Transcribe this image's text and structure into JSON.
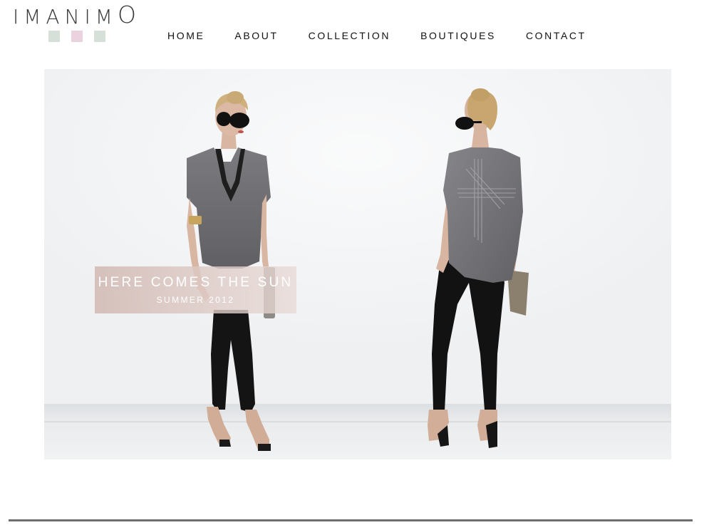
{
  "logo": {
    "text_main": "IMANIM",
    "text_last": "O",
    "squares": [
      "#d6e0d8",
      "#ead2df",
      "#d6e0d8"
    ]
  },
  "nav": {
    "items": [
      {
        "label": "HOME"
      },
      {
        "label": "ABOUT"
      },
      {
        "label": "COLLECTION"
      },
      {
        "label": "BOUTIQUES"
      },
      {
        "label": "CONTACT"
      }
    ]
  },
  "hero": {
    "caption_title": "HERE COMES THE SUN",
    "caption_subtitle": "SUMMER 2012",
    "caption_color": "#d9c3bd",
    "background_color": "#eef0f2"
  },
  "footer": {
    "rule_color": "#6e6e6e"
  }
}
